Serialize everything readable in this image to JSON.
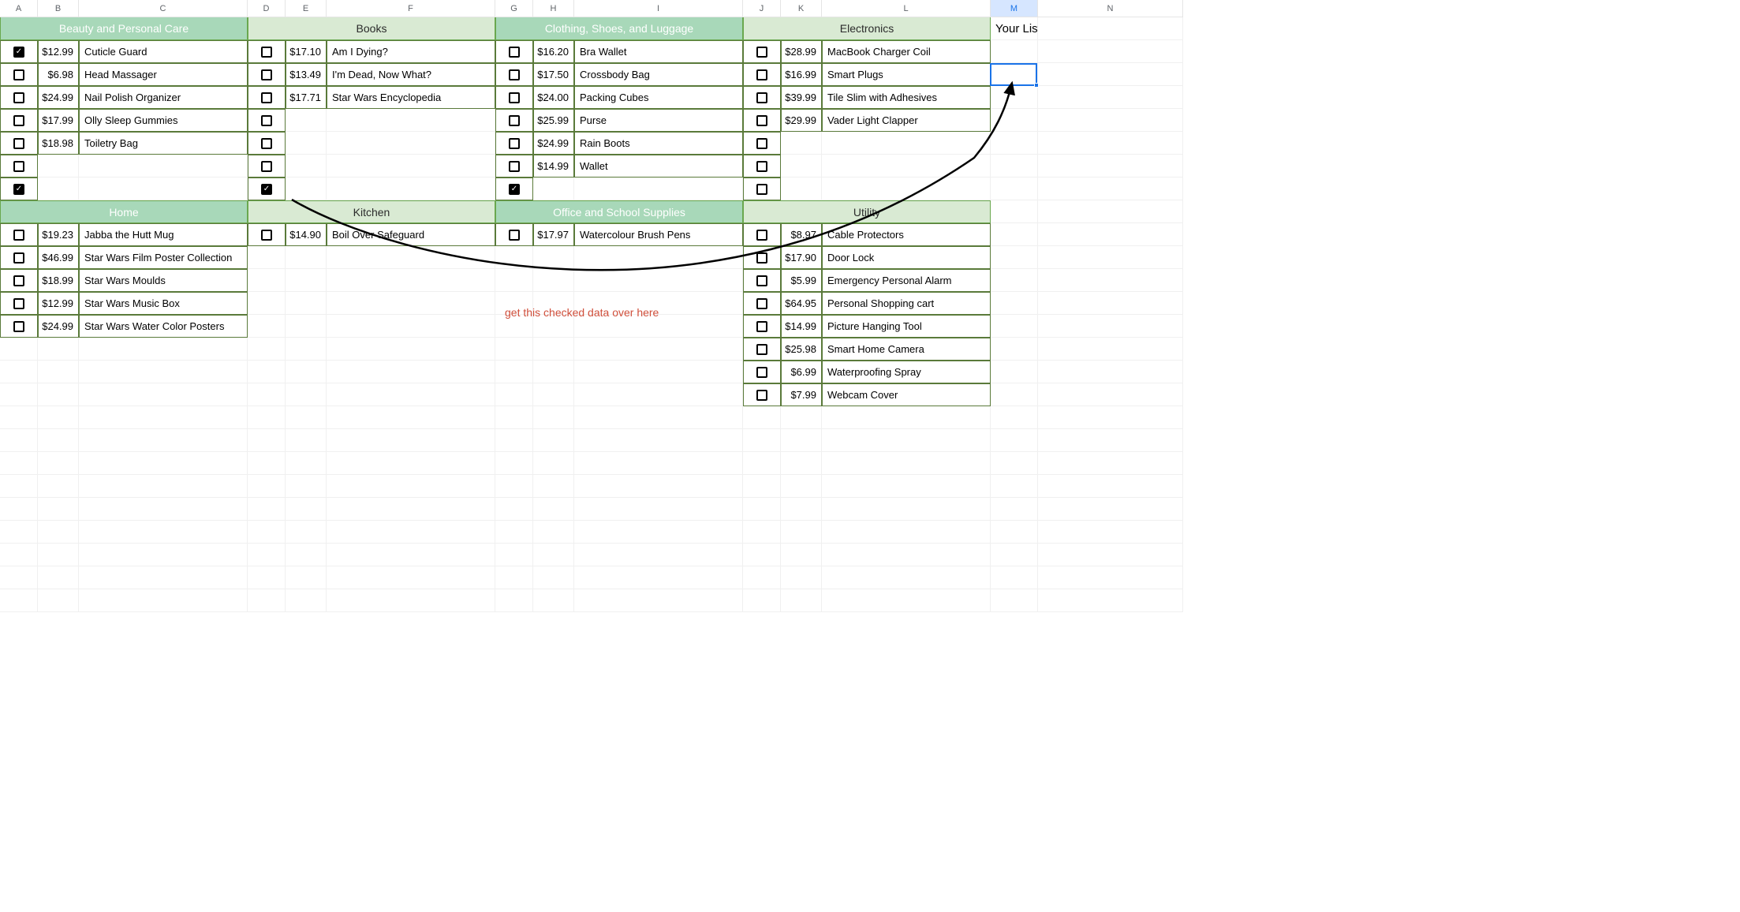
{
  "columns": [
    "A",
    "B",
    "C",
    "D",
    "E",
    "F",
    "G",
    "H",
    "I",
    "J",
    "K",
    "L",
    "M",
    "N"
  ],
  "selected_column": "M",
  "selected_cell": {
    "col": "M",
    "row_index": 3
  },
  "annotation_text": "get this checked data over here",
  "your_list_label": "Your List",
  "categories": [
    {
      "key": "beauty",
      "name": "Beauty and Personal Care",
      "header_style": "strong",
      "col_block": 0,
      "row_block": 0,
      "items": [
        {
          "price": "$12.99",
          "label": "Cuticle Guard",
          "checked": true
        },
        {
          "price": "$6.98",
          "label": "Head Massager",
          "checked": false
        },
        {
          "price": "$24.99",
          "label": "Nail Polish Organizer",
          "checked": false
        },
        {
          "price": "$17.99",
          "label": "Olly Sleep Gummies",
          "checked": false
        },
        {
          "price": "$18.98",
          "label": "Toiletry Bag",
          "checked": false
        }
      ],
      "trailing_checkboxes": [
        false,
        true
      ]
    },
    {
      "key": "books",
      "name": "Books",
      "header_style": "light",
      "col_block": 1,
      "row_block": 0,
      "items": [
        {
          "price": "$17.10",
          "label": "Am I Dying?",
          "checked": false
        },
        {
          "price": "$13.49",
          "label": "I'm Dead, Now What?",
          "checked": false
        },
        {
          "price": "$17.71",
          "label": "Star Wars Encyclopedia",
          "checked": false
        }
      ],
      "trailing_checkboxes": [
        false,
        false,
        false,
        true
      ]
    },
    {
      "key": "clothing",
      "name": "Clothing, Shoes, and Luggage",
      "header_style": "strong",
      "col_block": 2,
      "row_block": 0,
      "items": [
        {
          "price": "$16.20",
          "label": "Bra Wallet",
          "checked": false
        },
        {
          "price": "$17.50",
          "label": "Crossbody Bag",
          "checked": false
        },
        {
          "price": "$24.00",
          "label": "Packing Cubes",
          "checked": false
        },
        {
          "price": "$25.99",
          "label": "Purse",
          "checked": false
        },
        {
          "price": "$24.99",
          "label": "Rain Boots",
          "checked": false
        },
        {
          "price": "$14.99",
          "label": "Wallet",
          "checked": false
        }
      ],
      "trailing_checkboxes": [
        true
      ]
    },
    {
      "key": "electronics",
      "name": "Electronics",
      "header_style": "light",
      "col_block": 3,
      "row_block": 0,
      "items": [
        {
          "price": "$28.99",
          "label": "MacBook Charger Coil",
          "checked": false
        },
        {
          "price": "$16.99",
          "label": "Smart Plugs",
          "checked": false
        },
        {
          "price": "$39.99",
          "label": "Tile Slim with Adhesives",
          "checked": false
        },
        {
          "price": "$29.99",
          "label": "Vader Light Clapper",
          "checked": false
        }
      ],
      "trailing_checkboxes": [
        false,
        false,
        false
      ]
    },
    {
      "key": "home",
      "name": "Home",
      "header_style": "strong",
      "col_block": 0,
      "row_block": 1,
      "items": [
        {
          "price": "$19.23",
          "label": "Jabba the Hutt Mug",
          "checked": false
        },
        {
          "price": "$46.99",
          "label": "Star Wars Film Poster Collection",
          "checked": false
        },
        {
          "price": "$18.99",
          "label": "Star Wars Moulds",
          "checked": false
        },
        {
          "price": "$12.99",
          "label": "Star Wars Music Box",
          "checked": false
        },
        {
          "price": "$24.99",
          "label": "Star Wars Water Color Posters",
          "checked": false
        }
      ],
      "trailing_checkboxes": []
    },
    {
      "key": "kitchen",
      "name": "Kitchen",
      "header_style": "light",
      "col_block": 1,
      "row_block": 1,
      "items": [
        {
          "price": "$14.90",
          "label": "Boil Over Safeguard",
          "checked": false
        }
      ],
      "trailing_checkboxes": []
    },
    {
      "key": "office",
      "name": "Office and School Supplies",
      "header_style": "strong",
      "col_block": 2,
      "row_block": 1,
      "items": [
        {
          "price": "$17.97",
          "label": "Watercolour Brush Pens",
          "checked": false
        }
      ],
      "trailing_checkboxes": []
    },
    {
      "key": "utility",
      "name": "Utility",
      "header_style": "light",
      "col_block": 3,
      "row_block": 1,
      "items": [
        {
          "price": "$8.97",
          "label": "Cable Protectors",
          "checked": false
        },
        {
          "price": "$17.90",
          "label": "Door Lock",
          "checked": false
        },
        {
          "price": "$5.99",
          "label": "Emergency Personal Alarm",
          "checked": false
        },
        {
          "price": "$64.95",
          "label": "Personal Shopping cart",
          "checked": false
        },
        {
          "price": "$14.99",
          "label": "Picture Hanging Tool",
          "checked": false
        },
        {
          "price": "$25.98",
          "label": "Smart Home Camera",
          "checked": false
        },
        {
          "price": "$6.99",
          "label": "Waterproofing Spray",
          "checked": false
        },
        {
          "price": "$7.99",
          "label": "Webcam Cover",
          "checked": false
        }
      ],
      "trailing_checkboxes": []
    }
  ]
}
